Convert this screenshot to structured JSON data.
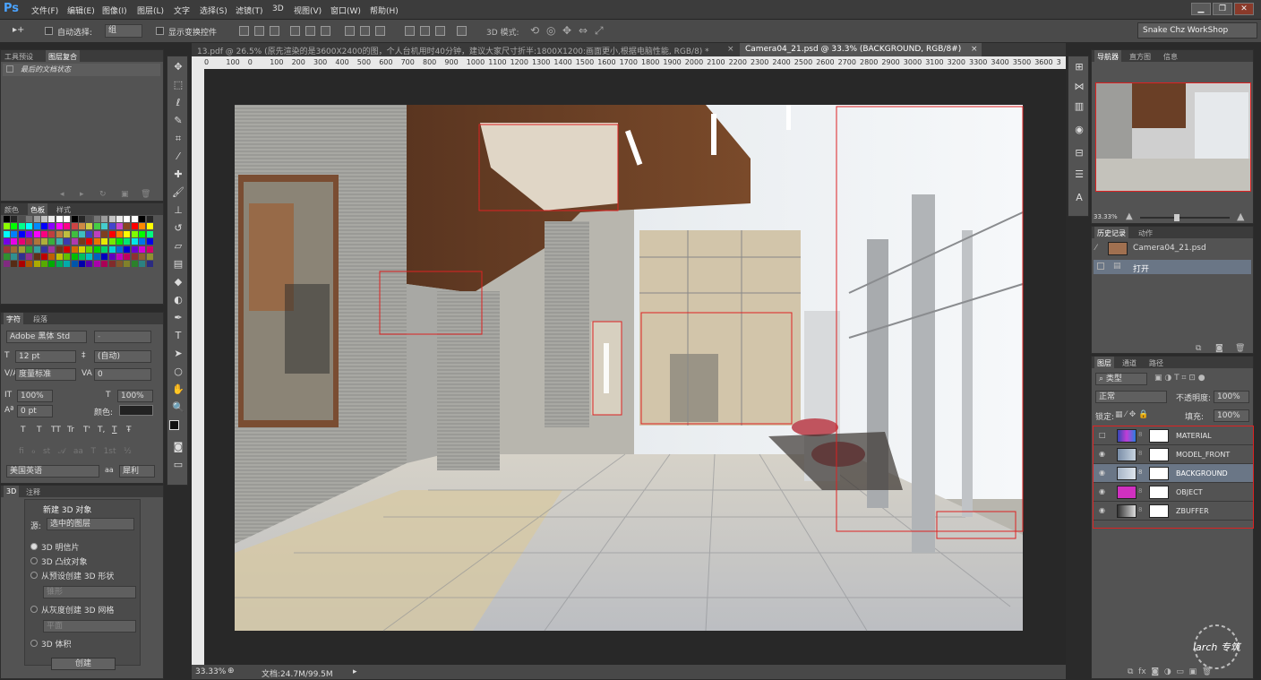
{
  "app": {
    "logo": "Ps"
  },
  "menu": [
    "文件(F)",
    "编辑(E)",
    "图像(I)",
    "图层(L)",
    "文字",
    "选择(S)",
    "滤镜(T)",
    "3D",
    "视图(V)",
    "窗口(W)",
    "帮助(H)"
  ],
  "options": {
    "auto_select_label": "自动选择:",
    "auto_select_value": "组",
    "show_transform": "显示变换控件",
    "mode_3d": "3D 模式:",
    "workspace": "Snake Chz WorkShop"
  },
  "doc_tabs": [
    {
      "label": "13.pdf @ 26.5% (原先渲染的是3600X2400的图，个人台机用时40分钟，建议大家尺寸折半:1800X1200:画面更小,根据电脑性能, RGB/8) *",
      "close": "×"
    },
    {
      "label": "Camera04_21.psd @ 33.3% (BACKGROUND, RGB/8#)",
      "close": "×"
    }
  ],
  "ruler_ticks": [
    "0",
    "100",
    "0",
    "100",
    "200",
    "300",
    "400",
    "500",
    "600",
    "700",
    "800",
    "900",
    "1000",
    "1100",
    "1200",
    "1300",
    "1400",
    "1500",
    "1600",
    "1700",
    "1800",
    "1900",
    "2000",
    "2100",
    "2200",
    "2300",
    "2400",
    "2500",
    "2600",
    "2700",
    "2800",
    "2900",
    "3000",
    "3100",
    "3200",
    "3300",
    "3400",
    "3500",
    "3600",
    "3"
  ],
  "left": {
    "history_tabs": [
      "工具预设",
      "图层复合"
    ],
    "history_item": "最后的文档状态",
    "color_tabs": [
      "颜色",
      "色板",
      "样式"
    ],
    "char_tabs": [
      "字符",
      "段落"
    ],
    "font_family": "Adobe 黑体 Std",
    "font_style": "-",
    "font_size": "12 pt",
    "leading": "(自动)",
    "kerning": "度量标准",
    "tracking": "0",
    "vscale": "100%",
    "hscale": "100%",
    "baseline": "0 pt",
    "color_label": "颜色:",
    "type_styles": [
      "T",
      "T",
      "TT",
      "Tr",
      "T'",
      "T,",
      "T",
      "Ŧ"
    ],
    "language": "美国英语",
    "aa_label": "aa",
    "aa_value": "犀利",
    "tdtabs": [
      "3D",
      "注释"
    ],
    "new3d_title": "新建 3D 对象",
    "source_label": "源:",
    "source_value": "选中的图层",
    "radios": [
      "3D 明信片",
      "3D 凸纹对象",
      "从预设创建 3D 形状",
      "从灰度创建 3D 网格",
      "3D 体积"
    ],
    "preset_value": "锥形",
    "gray_value": "平面",
    "create_button": "创建"
  },
  "status": {
    "zoom": "33.33%",
    "doc": "文档:24.7M/99.5M"
  },
  "right": {
    "nav_tabs": [
      "导航器",
      "直方图",
      "信息"
    ],
    "nav_zoom": "33.33%",
    "hist_tabs": [
      "历史记录",
      "动作"
    ],
    "hist_snapshot": "Camera04_21.psd",
    "hist_step": "打开",
    "layer_tabs": [
      "图层",
      "通道",
      "路径"
    ],
    "filter_kind": "类型",
    "blend_mode": "正常",
    "opacity_label": "不透明度:",
    "opacity": "100%",
    "lock_label": "锁定:",
    "fill_label": "填充:",
    "fill": "100%",
    "layers": [
      {
        "name": "MATERIAL",
        "visible": false
      },
      {
        "name": "MODEL_FRONT",
        "visible": true
      },
      {
        "name": "BACKGROUND",
        "visible": true,
        "selected": true
      },
      {
        "name": "OBJECT",
        "visible": true
      },
      {
        "name": "ZBUFFER",
        "visible": true
      }
    ]
  },
  "watermark": "iarch 专筑"
}
